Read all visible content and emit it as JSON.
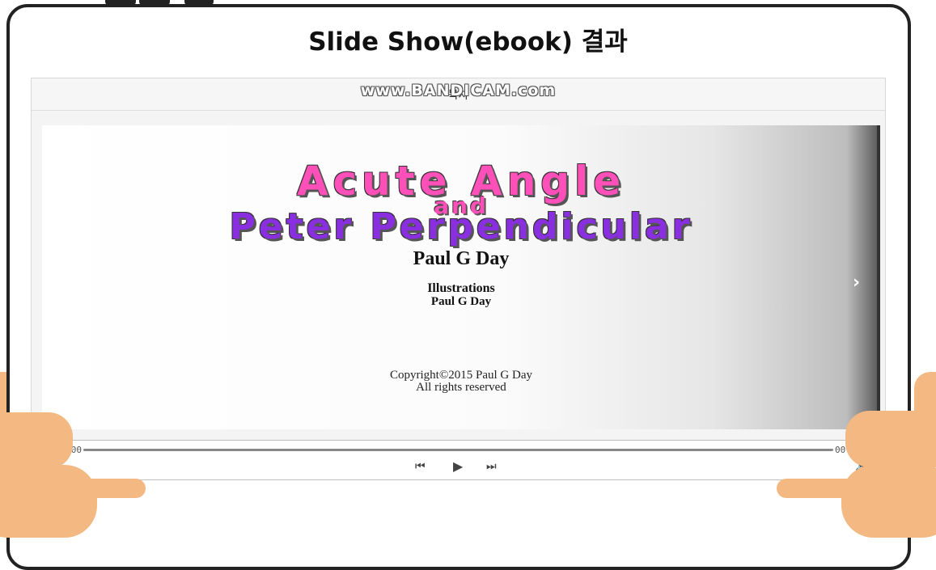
{
  "page_title": "Slide Show(ebook) 결과",
  "viewer": {
    "header_title": "목차",
    "watermark": "www.BANDICAM.com"
  },
  "slide": {
    "title_line1": "Acute Angle",
    "title_line2": "and",
    "title_line3": "Peter Perpendicular",
    "author": "Paul G Day",
    "illustrations_label": "Illustrations",
    "illustrator": "Paul G Day",
    "copyright": "Copyright©2015 Paul G Day",
    "rights": "All rights reserved",
    "next_glyph": "›"
  },
  "player": {
    "current_time": "00:00:00",
    "total_time": "00:00:00",
    "progress": 0,
    "prev_glyph": "⏮",
    "play_glyph": "▶",
    "next_glyph": "⏭",
    "volume_glyph": "🔊"
  },
  "colors": {
    "title_pink": "#ff4fb8",
    "title_purple": "#8a2fe0",
    "skin": "#f4b982"
  }
}
